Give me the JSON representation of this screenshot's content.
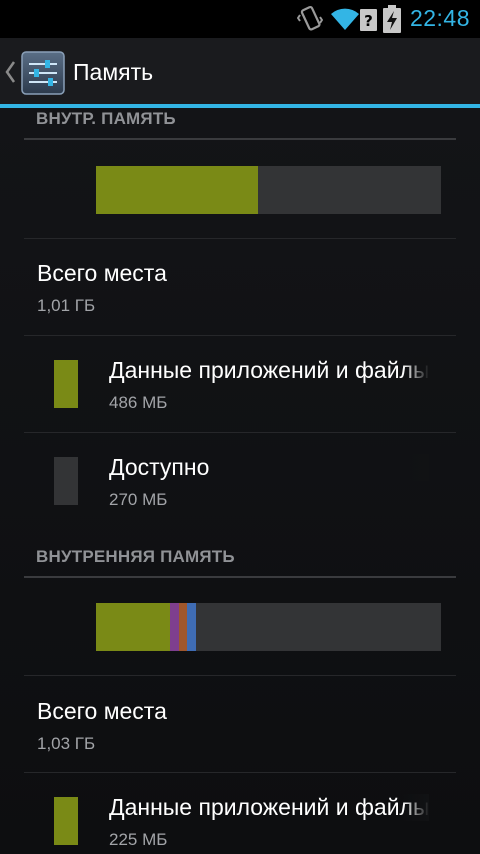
{
  "status_bar": {
    "time": "22:48",
    "icons": [
      "vibrate-icon",
      "wifi-icon",
      "signal-unknown-icon",
      "battery-charging-icon"
    ]
  },
  "action_bar": {
    "title": "Память",
    "app_icon": "settings-sliders-icon",
    "up_icon": "chevron-left-icon"
  },
  "colors": {
    "accent": "#33b5e5",
    "apps": "#7a8a16",
    "available": "#333436",
    "purple": "#7e3f8e",
    "brown": "#a0572c",
    "blue": "#3f6cb4"
  },
  "sections": [
    {
      "header": "ВНУТР. ПАМЯТЬ",
      "usage_bar": [
        {
          "name": "apps",
          "fraction": 0.47,
          "color": "#7a8a16"
        },
        {
          "name": "available",
          "fraction": 0.53,
          "color": "#333436"
        }
      ],
      "total": {
        "label": "Всего места",
        "value": "1,01 ГБ"
      },
      "categories": [
        {
          "label": "Данные приложений и файлы",
          "value": "486 МБ",
          "color": "#7a8a16"
        },
        {
          "label": "Доступно",
          "value": "270 МБ",
          "color": "#333436"
        }
      ]
    },
    {
      "header": "ВНУТРЕННЯЯ ПАМЯТЬ",
      "usage_bar": [
        {
          "name": "apps",
          "fraction": 0.215,
          "color": "#7a8a16"
        },
        {
          "name": "purple",
          "fraction": 0.025,
          "color": "#7e3f8e"
        },
        {
          "name": "brown",
          "fraction": 0.025,
          "color": "#a0572c"
        },
        {
          "name": "blue",
          "fraction": 0.025,
          "color": "#3f6cb4"
        },
        {
          "name": "available",
          "fraction": 0.71,
          "color": "#333436"
        }
      ],
      "total": {
        "label": "Всего места",
        "value": "1,03 ГБ"
      },
      "categories": [
        {
          "label": "Данные приложений и файлы",
          "value": "225 МБ",
          "color": "#7a8a16"
        }
      ]
    }
  ]
}
